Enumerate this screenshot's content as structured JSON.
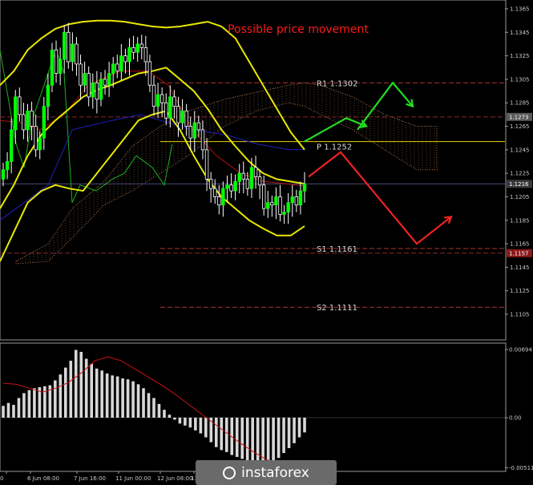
{
  "chart_data": {
    "type": "line",
    "title": "Possible price movement",
    "x_tick_labels": [
      "0",
      "6 Jun 08:00",
      "7 Jun 16:00",
      "11 Jun 00:00",
      "12 Jun 08:00",
      "13 Jun"
    ],
    "price_axis": {
      "ylim": [
        1.1095,
        1.137
      ],
      "ticks": [
        1.1365,
        1.1345,
        1.1325,
        1.1305,
        1.1285,
        1.1265,
        1.1245,
        1.1225,
        1.1205,
        1.1185,
        1.1165,
        1.1145,
        1.1125,
        1.1105
      ]
    },
    "current_price_tags": [
      {
        "value": "1.1273",
        "color": "#5a5a5a"
      },
      {
        "value": "1.1216",
        "color": "#3a3a3a"
      },
      {
        "value": "1.1157",
        "color": "#8b1a1a"
      }
    ],
    "levels": [
      {
        "label": "R1 1.1302",
        "value": 1.1302,
        "color": "#a33"
      },
      {
        "label": "P 1.1252",
        "value": 1.1252,
        "color": "#e6d200"
      },
      {
        "label": "S1 1.1161",
        "value": 1.1161,
        "color": "#a33"
      },
      {
        "label": "S2 1.1111",
        "value": 1.1111,
        "color": "#a33"
      }
    ],
    "candles_close": [
      1.1228,
      1.1235,
      1.1262,
      1.129,
      1.1275,
      1.1262,
      1.1278,
      1.1265,
      1.1245,
      1.1255,
      1.1282,
      1.13,
      1.133,
      1.131,
      1.1322,
      1.1345,
      1.132,
      1.1335,
      1.1318,
      1.13,
      1.131,
      1.129,
      1.1302,
      1.1288,
      1.1305,
      1.13,
      1.131,
      1.1318,
      1.1312,
      1.1325,
      1.132,
      1.1332,
      1.1328,
      1.1335,
      1.1332,
      1.132,
      1.13,
      1.1282,
      1.1292,
      1.1285,
      1.1272,
      1.129,
      1.1282,
      1.1268,
      1.1278,
      1.1265,
      1.1255,
      1.1268,
      1.1262,
      1.1245,
      1.122,
      1.1212,
      1.1205,
      1.1198,
      1.1212,
      1.1215,
      1.121,
      1.1218,
      1.1225,
      1.122,
      1.1212,
      1.123,
      1.1222,
      1.1215,
      1.1195,
      1.12,
      1.1198,
      1.1205,
      1.119,
      1.1192,
      1.12,
      1.1205,
      1.1198,
      1.121,
      1.1216
    ],
    "bollinger": {
      "upper": [
        1.13,
        1.1312,
        1.133,
        1.134,
        1.1348,
        1.1352,
        1.1354,
        1.1355,
        1.1355,
        1.1354,
        1.1352,
        1.135,
        1.1349,
        1.135,
        1.1352,
        1.1354,
        1.135,
        1.134,
        1.132,
        1.13,
        1.128,
        1.126,
        1.1245
      ],
      "middle": [
        1.1195,
        1.1215,
        1.124,
        1.1258,
        1.127,
        1.128,
        1.129,
        1.1296,
        1.13,
        1.1305,
        1.131,
        1.1312,
        1.1315,
        1.1305,
        1.1295,
        1.128,
        1.1262,
        1.1248,
        1.1235,
        1.1225,
        1.122,
        1.1218,
        1.1216
      ],
      "lower": [
        1.115,
        1.1175,
        1.12,
        1.121,
        1.1215,
        1.1212,
        1.121,
        1.1225,
        1.124,
        1.1255,
        1.127,
        1.1275,
        1.1278,
        1.1262,
        1.124,
        1.122,
        1.1205,
        1.1195,
        1.1185,
        1.1178,
        1.1172,
        1.1172,
        1.118
      ]
    },
    "forecast": {
      "green": [
        [
          1.1252,
          1.1262
        ],
        [
          1.1272,
          1.1265
        ],
        [
          1.1302,
          1.1282
        ]
      ],
      "red": [
        [
          1.1243,
          1.1252
        ],
        [
          1.1165,
          1.1188
        ]
      ]
    },
    "macd": {
      "ylim": [
        -0.0055,
        0.0072
      ],
      "ticks": [
        "0.00694",
        "0.00",
        "-0.00511"
      ],
      "histogram": [
        0.0012,
        0.0015,
        0.0013,
        0.002,
        0.0025,
        0.0028,
        0.003,
        0.0031,
        0.0032,
        0.0033,
        0.0038,
        0.0044,
        0.0051,
        0.0058,
        0.0069,
        0.0067,
        0.006,
        0.0055,
        0.005,
        0.0048,
        0.0045,
        0.0043,
        0.0042,
        0.004,
        0.0039,
        0.0037,
        0.0034,
        0.003,
        0.0025,
        0.002,
        0.0014,
        0.0008,
        0.0003,
        -0.0002,
        -0.0006,
        -0.0008,
        -0.001,
        -0.0013,
        -0.0016,
        -0.002,
        -0.0025,
        -0.003,
        -0.0033,
        -0.0035,
        -0.0038,
        -0.004,
        -0.0042,
        -0.0044,
        -0.0045,
        -0.0046,
        -0.0047,
        -0.0046,
        -0.0044,
        -0.0041,
        -0.0036,
        -0.0031,
        -0.0026,
        -0.002,
        -0.0015
      ],
      "signal": [
        0.0035,
        0.0034,
        0.003,
        0.0026,
        0.003,
        0.0036,
        0.0046,
        0.0058,
        0.0062,
        0.0058,
        0.005,
        0.0042,
        0.0034,
        0.0025,
        0.0015,
        0.0005,
        -0.0005,
        -0.0015,
        -0.0025,
        -0.0034,
        -0.0042,
        -0.0048,
        -0.005,
        -0.0048
      ]
    }
  },
  "branding": {
    "logo_text": "instaforex"
  }
}
